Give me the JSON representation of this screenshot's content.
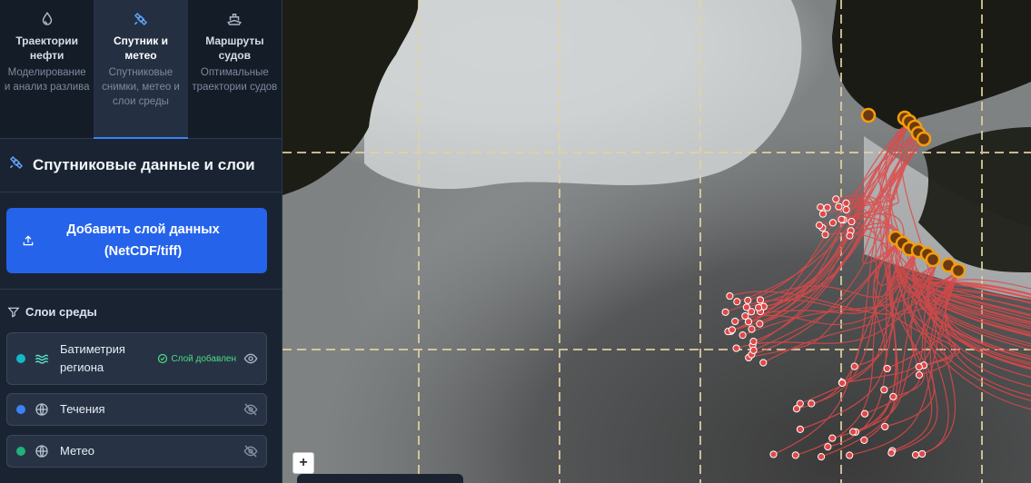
{
  "tabs": [
    {
      "title": "Траектории нефти",
      "subtitle": "Моделирование и анализ разлива",
      "icon": "droplet-icon",
      "active": false
    },
    {
      "title": "Спутник и метео",
      "subtitle": "Спутниковые снимки, метео и слои среды",
      "icon": "satellite-icon",
      "active": true
    },
    {
      "title": "Маршруты судов",
      "subtitle": "Оптимальные траектории судов",
      "icon": "ship-icon",
      "active": false
    }
  ],
  "section": {
    "title": "Спутниковые данные и слои",
    "icon": "satellite-icon"
  },
  "add_layer": {
    "label": "Добавить слой данных (NetCDF/tiff)",
    "icon": "upload-icon"
  },
  "env_layers": {
    "title": "Слои среды",
    "icon": "filter-icon",
    "items": [
      {
        "name": "Батиметрия региона",
        "color": "#14b8c8",
        "icon": "waves-icon",
        "badge": "Слой добавлен",
        "visible": true
      },
      {
        "name": "Течения",
        "color": "#3b82f6",
        "icon": "globe-icon",
        "badge": "",
        "visible": false
      },
      {
        "name": "Метео",
        "color": "#22b07d",
        "icon": "globe-icon",
        "badge": "",
        "visible": false
      }
    ]
  },
  "map": {
    "zoom_in_label": "+"
  },
  "colors": {
    "accent": "#2563eb",
    "trajectory": "#e04848",
    "source_marker": "#f59e0b"
  }
}
